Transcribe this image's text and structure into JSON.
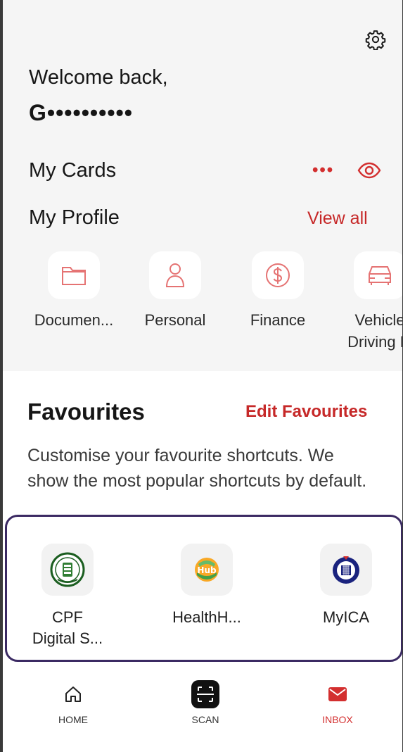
{
  "colors": {
    "accent": "#d32f2f",
    "frame_highlight": "#3b2a63",
    "top_background": "#f5f5f5"
  },
  "header": {
    "settings_icon": "gear-icon",
    "welcome_text": "Welcome back,",
    "masked_name": "G••••••••••"
  },
  "my_cards": {
    "title": "My Cards",
    "more_label": "•••",
    "visibility_icon": "eye-icon"
  },
  "my_profile": {
    "title": "My Profile",
    "view_all": "View all",
    "tiles": [
      {
        "label": "Documen...",
        "icon": "folder-icon"
      },
      {
        "label": "Personal",
        "icon": "person-icon"
      },
      {
        "label": "Finance",
        "icon": "dollar-icon"
      },
      {
        "label": "Vehicle\nDriving Li",
        "icon": "car-icon"
      }
    ]
  },
  "favourites": {
    "title": "Favourites",
    "edit_label": "Edit Favourites",
    "description": "Customise your favourite shortcuts. We show the most popular shortcuts by default.",
    "items": [
      {
        "label": "CPF\nDigital S...",
        "icon": "cpf-logo-icon"
      },
      {
        "label": "HealthH...",
        "icon": "healthhub-logo-icon",
        "logo_text": "Hub"
      },
      {
        "label": "MyICA",
        "icon": "ica-logo-icon"
      }
    ]
  },
  "bottom_nav": {
    "items": [
      {
        "label": "HOME",
        "icon": "home-icon",
        "active": false
      },
      {
        "label": "SCAN",
        "icon": "scan-icon",
        "active": false
      },
      {
        "label": "INBOX",
        "icon": "mail-icon",
        "active": true
      }
    ]
  }
}
